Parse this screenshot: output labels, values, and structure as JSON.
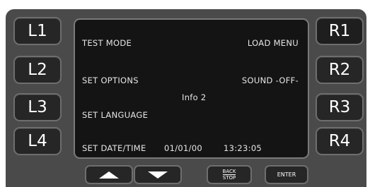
{
  "left_buttons": [
    {
      "label": "L1"
    },
    {
      "label": "L2"
    },
    {
      "label": "L3"
    },
    {
      "label": "L4"
    }
  ],
  "right_buttons": [
    {
      "label": "R1"
    },
    {
      "label": "R2"
    },
    {
      "label": "R3"
    },
    {
      "label": "R4"
    }
  ],
  "screen": {
    "left_items": [
      {
        "label": "TEST MODE"
      },
      {
        "label": "SET OPTIONS"
      },
      {
        "label": "SET LANGUAGE"
      },
      {
        "label": "SET DATE/TIME"
      }
    ],
    "right_items": [
      {
        "label": "LOAD MENU"
      },
      {
        "label": "SOUND -OFF-"
      }
    ],
    "info": "Info 2",
    "date": "01/01/00",
    "time": "13:23:05"
  },
  "bottom_buttons": {
    "up_icon": "up-arrow-icon",
    "down_icon": "down-arrow-icon",
    "back_line1": "BACK",
    "back_line2": "STOP",
    "enter": "ENTER"
  },
  "colors": {
    "bezel": "#4a4a4a",
    "button": "#262626",
    "screen": "#141414",
    "text": "#e6e6e6"
  }
}
